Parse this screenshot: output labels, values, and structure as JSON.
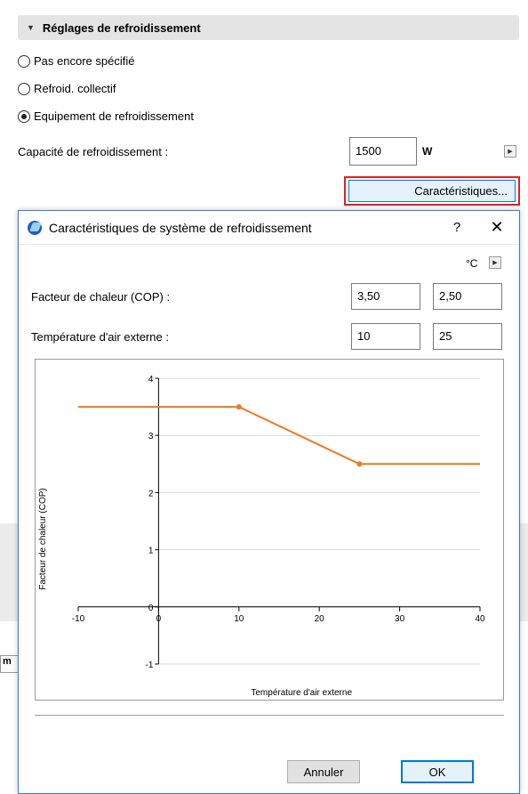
{
  "settings": {
    "section_title": "Réglages de refroidissement",
    "radio_options": [
      {
        "label": "Pas encore spécifié",
        "checked": false
      },
      {
        "label": "Refroid. collectif",
        "checked": false
      },
      {
        "label": "Equipement de refroidissement",
        "checked": true
      }
    ],
    "capacity_label": "Capacité de refroidissement :",
    "capacity_value": "1500",
    "capacity_unit": "W",
    "characteristics_button": "Caractéristiques..."
  },
  "background": {
    "partial_label": "m"
  },
  "dialog": {
    "title": "Caractéristiques de système de refroidissement",
    "help": "?",
    "close": "✕",
    "temp_unit": "°C",
    "cop_label": "Facteur de chaleur (COP) :",
    "cop_values": [
      "3,50",
      "2,50"
    ],
    "temp_label": "Température d'air externe :",
    "temp_values": [
      "10",
      "25"
    ],
    "cancel_button": "Annuler",
    "ok_button": "OK"
  },
  "chart_data": {
    "type": "line",
    "xlabel": "Température d'air externe",
    "ylabel": "Facteur de chaleur (COP)",
    "xlim": [
      -10,
      40
    ],
    "ylim": [
      -1,
      4
    ],
    "x_ticks": [
      "-10",
      "0",
      "10",
      "20",
      "30",
      "40"
    ],
    "y_ticks": [
      "4",
      "3",
      "2",
      "1",
      "0",
      "-1"
    ],
    "series": [
      {
        "x": [
          -10,
          10,
          25,
          40
        ],
        "y": [
          3.5,
          3.5,
          2.5,
          2.5
        ],
        "markers": [
          10,
          25
        ]
      }
    ],
    "color": "#f07820",
    "grid": true
  }
}
